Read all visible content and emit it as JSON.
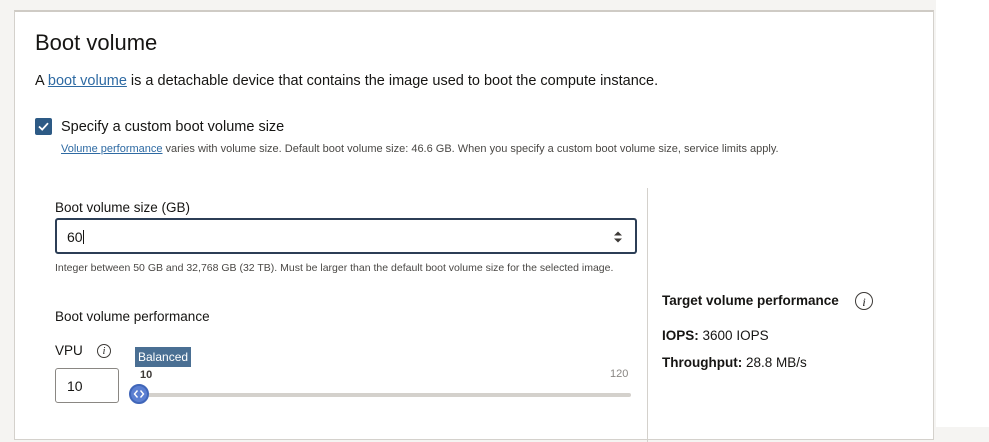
{
  "section": {
    "title": "Boot volume",
    "desc_prefix": "A ",
    "desc_link": "boot volume",
    "desc_suffix": " is a detachable device that contains the image used to boot the compute instance."
  },
  "custom_size": {
    "checked": true,
    "label": "Specify a custom boot volume size",
    "help_link": "Volume performance",
    "help_text": " varies with volume size. Default boot volume size: 46.6 GB. When you specify a custom boot volume size, service limits apply."
  },
  "size_field": {
    "label": "Boot volume size (GB)",
    "value": "60",
    "help": "Integer between 50 GB and 32,768 GB (32 TB). Must be larger than the default boot volume size for the selected image."
  },
  "performance": {
    "label": "Boot volume performance",
    "vpu_label": "VPU",
    "vpu_value": "10",
    "badge": "Balanced",
    "slider_min": "10",
    "slider_max": "120",
    "slider_value": 10
  },
  "target": {
    "title": "Target volume performance",
    "iops_label": "IOPS:",
    "iops_value": "3600 IOPS",
    "throughput_label": "Throughput:",
    "throughput_value": "28.8 MB/s"
  },
  "icons": [
    "info-icon",
    "checkmark-icon",
    "spinner-arrows-icon",
    "slider-handle-icon"
  ],
  "colors": {
    "accent": "#2d5a85",
    "link": "#2e6aa3",
    "badge": "#4a6f93",
    "thumb": "#5b7fd1"
  }
}
